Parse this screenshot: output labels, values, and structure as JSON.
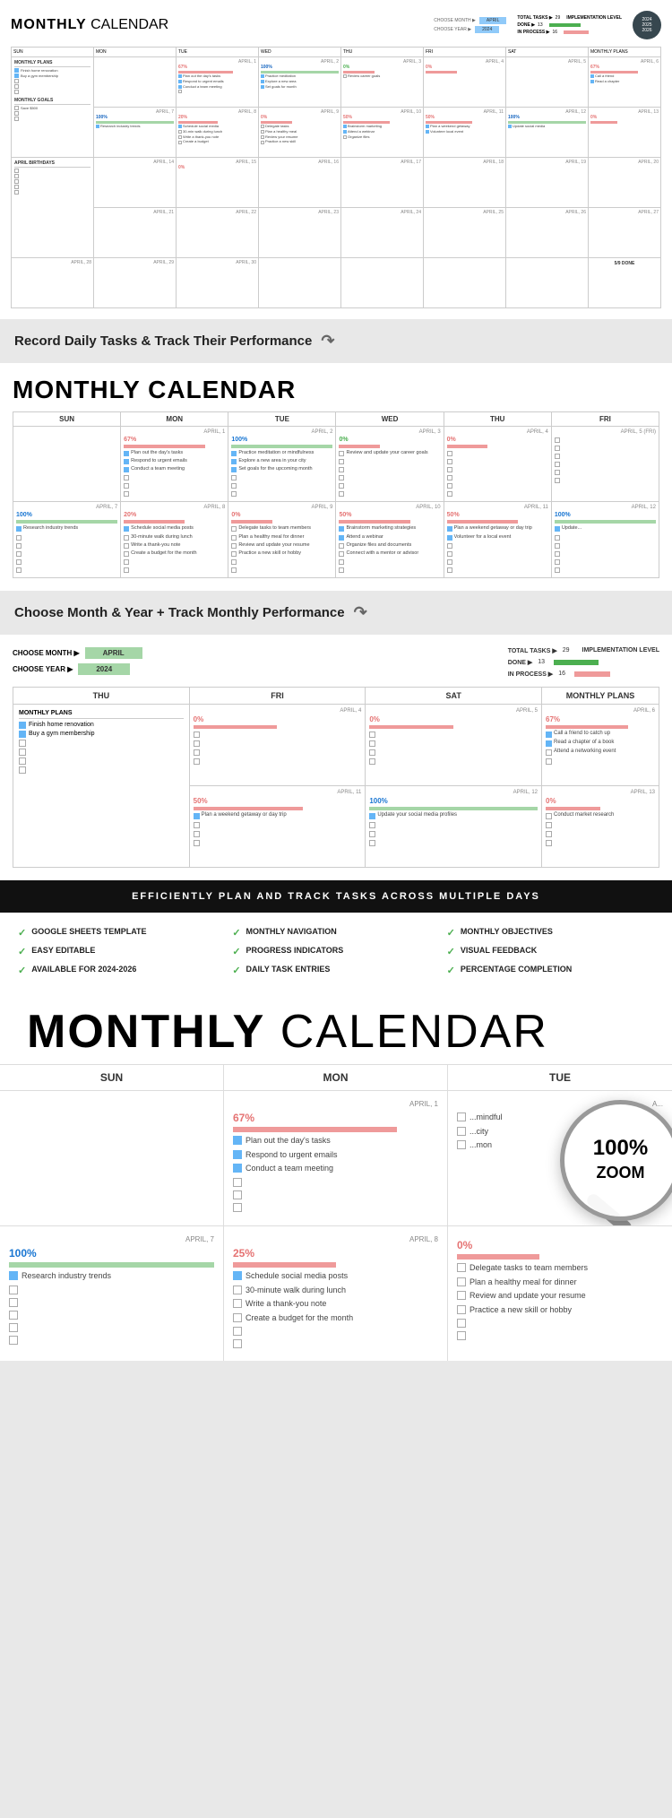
{
  "section1": {
    "title_bold": "MONTHLY",
    "title_light": " CALENDAR",
    "choose_month_label": "CHOOSE MONTH ▶",
    "choose_month_val": "APRIL",
    "choose_year_label": "CHOOSE YEAR ▶",
    "choose_year_val": "2024",
    "total_tasks_label": "TOTAL TASKS ▶",
    "total_tasks_val": "29",
    "done_label": "DONE ▶",
    "done_val": "13",
    "in_process_label": "IN PROCESS ▶",
    "in_process_val": "16",
    "impl_label": "IMPLEMENTATION LEVEL",
    "year_badge": [
      "2024",
      "2025",
      "2026"
    ],
    "days": [
      "SUN",
      "MON",
      "TUE",
      "WED",
      "THU",
      "FRI",
      "SAT"
    ],
    "right_panel_plans_title": "MONTHLY PLANS",
    "right_panel_plans": [
      "Finish home renovation",
      "Buy a gym membership",
      "",
      "",
      "",
      ""
    ],
    "right_panel_goals_title": "MONTHLY GOALS",
    "right_panel_goals": [
      "Save $500",
      "",
      "",
      "",
      ""
    ],
    "right_panel_bday_title": "APRIL BIRTHDAYS",
    "right_panel_bday": [
      "",
      "",
      "",
      "",
      ""
    ],
    "done_note": "5/9 DONE"
  },
  "divider1": {
    "text": "Record Daily Tasks & Track Their Performance"
  },
  "section2": {
    "title_bold": "MONTHLY",
    "title_light": " CALENDAR",
    "days": [
      "SUN",
      "MON",
      "TUE",
      "WED",
      "THU",
      "FRI"
    ],
    "row1": [
      {
        "date": "",
        "pct": "",
        "pct_class": "",
        "bar_class": "",
        "tasks": []
      },
      {
        "date": "APRIL, 1",
        "pct": "67%",
        "pct_class": "red",
        "bar_class": "pink",
        "tasks": [
          {
            "checked": true,
            "text": "Plan out the day's tasks"
          },
          {
            "checked": true,
            "text": "Respond to urgent emails"
          },
          {
            "checked": true,
            "text": "Conduct a team meeting"
          },
          {
            "checked": false,
            "text": ""
          },
          {
            "checked": false,
            "text": ""
          },
          {
            "checked": false,
            "text": ""
          }
        ]
      },
      {
        "date": "APRIL, 2",
        "pct": "100%",
        "pct_class": "blue",
        "bar_class": "green-bar",
        "tasks": [
          {
            "checked": true,
            "text": "Practice meditation or mindfulness"
          },
          {
            "checked": true,
            "text": "Explore a new area in your city"
          },
          {
            "checked": true,
            "text": "Set goals for the upcoming month"
          },
          {
            "checked": false,
            "text": ""
          },
          {
            "checked": false,
            "text": ""
          },
          {
            "checked": false,
            "text": ""
          }
        ]
      },
      {
        "date": "APRIL, 3",
        "pct": "0%",
        "pct_class": "green",
        "bar_class": "pink",
        "tasks": [
          {
            "checked": false,
            "text": "Review and update your career goals"
          },
          {
            "checked": false,
            "text": ""
          },
          {
            "checked": false,
            "text": ""
          },
          {
            "checked": false,
            "text": ""
          },
          {
            "checked": false,
            "text": ""
          },
          {
            "checked": false,
            "text": ""
          }
        ]
      },
      {
        "date": "APRIL, 4",
        "pct": "0%",
        "pct_class": "red",
        "bar_class": "pink",
        "tasks": [
          {
            "checked": false,
            "text": ""
          },
          {
            "checked": false,
            "text": ""
          },
          {
            "checked": false,
            "text": ""
          },
          {
            "checked": false,
            "text": ""
          },
          {
            "checked": false,
            "text": ""
          },
          {
            "checked": false,
            "text": ""
          }
        ]
      },
      {
        "date": "APRIL, 5 (FRI partial)",
        "pct": "",
        "pct_class": "",
        "bar_class": "",
        "tasks": []
      }
    ],
    "row2": [
      {
        "date": "APRIL, 7",
        "pct": "100%",
        "pct_class": "blue",
        "bar_class": "green-bar",
        "tasks": [
          {
            "checked": true,
            "text": "Research industry trends"
          },
          {
            "checked": false,
            "text": ""
          },
          {
            "checked": false,
            "text": ""
          },
          {
            "checked": false,
            "text": ""
          },
          {
            "checked": false,
            "text": ""
          },
          {
            "checked": false,
            "text": ""
          }
        ]
      },
      {
        "date": "APRIL, 8",
        "pct": "20%",
        "pct_class": "red",
        "bar_class": "pink",
        "tasks": [
          {
            "checked": true,
            "text": "Schedule social media posts"
          },
          {
            "checked": false,
            "text": "30-minute walk during lunch"
          },
          {
            "checked": false,
            "text": "Write a thank-you note"
          },
          {
            "checked": false,
            "text": "Create a budget for the month"
          },
          {
            "checked": false,
            "text": ""
          },
          {
            "checked": false,
            "text": ""
          }
        ]
      },
      {
        "date": "APRIL, 9",
        "pct": "0%",
        "pct_class": "red",
        "bar_class": "pink",
        "tasks": [
          {
            "checked": false,
            "text": "Delegate tasks to team members"
          },
          {
            "checked": false,
            "text": "Plan a healthy meal for dinner"
          },
          {
            "checked": false,
            "text": "Review and update your resume"
          },
          {
            "checked": false,
            "text": "Practice a new skill or hobby"
          },
          {
            "checked": false,
            "text": ""
          },
          {
            "checked": false,
            "text": ""
          }
        ]
      },
      {
        "date": "APRIL, 10",
        "pct": "50%",
        "pct_class": "red",
        "bar_class": "pink",
        "tasks": [
          {
            "checked": true,
            "text": "Brainstorm marketing strategies"
          },
          {
            "checked": true,
            "text": "Attend a webinar"
          },
          {
            "checked": false,
            "text": "Organize files and documents"
          },
          {
            "checked": false,
            "text": "Connect with a mentor or advisor"
          },
          {
            "checked": false,
            "text": ""
          },
          {
            "checked": false,
            "text": ""
          }
        ]
      },
      {
        "date": "APRIL, 11",
        "pct": "50%",
        "pct_class": "red",
        "bar_class": "pink",
        "tasks": [
          {
            "checked": true,
            "text": "Plan a weekend getaway or day trip"
          },
          {
            "checked": true,
            "text": "Volunteer for a local event"
          },
          {
            "checked": false,
            "text": ""
          },
          {
            "checked": false,
            "text": ""
          },
          {
            "checked": false,
            "text": ""
          },
          {
            "checked": false,
            "text": ""
          }
        ]
      },
      {
        "date": "APRIL, 12 (partial)",
        "pct": "100%",
        "pct_class": "blue",
        "bar_class": "green-bar",
        "tasks": [
          {
            "checked": false,
            "text": "Update..."
          },
          {
            "checked": false,
            "text": ""
          },
          {
            "checked": false,
            "text": ""
          },
          {
            "checked": false,
            "text": ""
          },
          {
            "checked": false,
            "text": ""
          },
          {
            "checked": false,
            "text": ""
          }
        ]
      }
    ]
  },
  "divider2": {
    "text": "Choose Month & Year + Track Monthly Performance"
  },
  "section3": {
    "choose_month_label": "CHOOSE MONTH ▶",
    "choose_month_val": "APRIL",
    "choose_year_label": "CHOOSE YEAR ▶",
    "choose_year_val": "2024",
    "total_tasks_label": "TOTAL TASKS ▶",
    "total_tasks_val": "29",
    "done_label": "DONE ▶",
    "done_val": "13",
    "in_process_label": "IN PROCESS ▶",
    "in_process_val": "16",
    "impl_label": "IMPLEMENTATION LEVEL",
    "days_partial": [
      "THU",
      "FRI",
      "SAT",
      "MONTHLY PLANS"
    ],
    "monthly_plans": [
      "Finish home renovation",
      "Buy a gym membership",
      "",
      "",
      "",
      ""
    ],
    "row1": [
      {
        "date": "APRIL, 4",
        "pct": "0%",
        "pct_class": "red",
        "bar_class": "pink",
        "tasks": [
          {
            "checked": false,
            "text": ""
          },
          {
            "checked": false,
            "text": ""
          },
          {
            "checked": false,
            "text": ""
          },
          {
            "checked": false,
            "text": ""
          }
        ]
      },
      {
        "date": "APRIL, 5",
        "pct": "0%",
        "pct_class": "red",
        "bar_class": "pink",
        "tasks": [
          {
            "checked": false,
            "text": ""
          },
          {
            "checked": false,
            "text": ""
          },
          {
            "checked": false,
            "text": ""
          },
          {
            "checked": false,
            "text": ""
          }
        ]
      },
      {
        "date": "APRIL, 6",
        "pct": "67%",
        "pct_class": "red",
        "bar_class": "pink",
        "tasks": [
          {
            "checked": true,
            "text": "Call a friend to catch up"
          },
          {
            "checked": true,
            "text": "Read a chapter of a book"
          },
          {
            "checked": false,
            "text": "Attend a networking event"
          },
          {
            "checked": false,
            "text": ""
          }
        ]
      }
    ],
    "row2": [
      {
        "date": "APRIL, 11",
        "pct": "50%",
        "pct_class": "red",
        "bar_class": "pink",
        "tasks": [
          {
            "checked": true,
            "text": "Plan a weekend getaway or day trip"
          },
          {
            "checked": false,
            "text": ""
          },
          {
            "checked": false,
            "text": ""
          },
          {
            "checked": false,
            "text": ""
          }
        ]
      },
      {
        "date": "APRIL, 12",
        "pct": "100%",
        "pct_class": "blue",
        "bar_class": "green-bar",
        "tasks": [
          {
            "checked": true,
            "text": "Update your social media profiles"
          },
          {
            "checked": false,
            "text": ""
          },
          {
            "checked": false,
            "text": ""
          },
          {
            "checked": false,
            "text": ""
          }
        ]
      },
      {
        "date": "APRIL, 13",
        "pct": "0%",
        "pct_class": "red",
        "bar_class": "pink",
        "tasks": [
          {
            "checked": false,
            "text": "Conduct market research"
          },
          {
            "checked": false,
            "text": ""
          },
          {
            "checked": false,
            "text": ""
          },
          {
            "checked": false,
            "text": ""
          }
        ]
      }
    ]
  },
  "black_banner": {
    "text": "EFFICIENTLY PLAN AND TRACK TASKS ACROSS MULTIPLE DAYS"
  },
  "features": [
    {
      "check": "✓",
      "text": "GOOGLE SHEETS TEMPLATE"
    },
    {
      "check": "✓",
      "text": "MONTHLY NAVIGATION"
    },
    {
      "check": "✓",
      "text": "MONTHLY OBJECTIVES"
    },
    {
      "check": "✓",
      "text": "EASY EDITABLE"
    },
    {
      "check": "✓",
      "text": "PROGRESS INDICATORS"
    },
    {
      "check": "✓",
      "text": "VISUAL FEEDBACK"
    },
    {
      "check": "✓",
      "text": "AVAILABLE FOR 2024-2026"
    },
    {
      "check": "✓",
      "text": "DAILY TASK ENTRIES"
    },
    {
      "check": "✓",
      "text": "PERCENTAGE COMPLETION"
    }
  ],
  "section4": {
    "title_bold": "MONTHLY",
    "title_light": " CALENDAR",
    "days": [
      "SUN",
      "MON",
      "TUE"
    ],
    "zoom_text": "100%\nZOOM",
    "row1": [
      {
        "date": "",
        "pct": "",
        "pct_class": "",
        "tasks": []
      },
      {
        "date": "APRIL, 1",
        "pct": "67%",
        "pct_class": "red",
        "bar_class": "pink",
        "tasks": [
          {
            "checked": true,
            "text": "Plan out the day's tasks"
          },
          {
            "checked": true,
            "text": "Respond to urgent emails"
          },
          {
            "checked": true,
            "text": "Conduct a team meeting"
          },
          {
            "checked": false,
            "text": ""
          },
          {
            "checked": false,
            "text": ""
          },
          {
            "checked": false,
            "text": ""
          }
        ]
      },
      {
        "date": "A...",
        "pct": "",
        "pct_class": "",
        "bar_class": "",
        "tasks": [
          {
            "checked": false,
            "text": "...mindful"
          },
          {
            "checked": false,
            "text": "...city"
          },
          {
            "checked": false,
            "text": "...mon"
          },
          {
            "checked": false,
            "text": ""
          },
          {
            "checked": false,
            "text": ""
          },
          {
            "checked": false,
            "text": ""
          }
        ]
      }
    ],
    "row2": [
      {
        "date": "APRIL, 7",
        "pct": "100%",
        "pct_class": "blue",
        "bar_class": "green-bar",
        "tasks": [
          {
            "checked": true,
            "text": "Research industry trends"
          },
          {
            "checked": false,
            "text": ""
          },
          {
            "checked": false,
            "text": ""
          },
          {
            "checked": false,
            "text": ""
          },
          {
            "checked": false,
            "text": ""
          },
          {
            "checked": false,
            "text": ""
          }
        ]
      },
      {
        "date": "APRIL, 8",
        "pct": "25%",
        "pct_class": "red",
        "bar_class": "pink",
        "tasks": [
          {
            "checked": true,
            "text": "Schedule social media posts"
          },
          {
            "checked": false,
            "text": "30-minute walk during lunch"
          },
          {
            "checked": false,
            "text": "Write a thank-you note"
          },
          {
            "checked": false,
            "text": "Create a budget for the month"
          },
          {
            "checked": false,
            "text": ""
          },
          {
            "checked": false,
            "text": ""
          }
        ]
      },
      {
        "date": "",
        "pct": "0%",
        "pct_class": "red",
        "bar_class": "pink",
        "tasks": [
          {
            "checked": false,
            "text": "Delegate tasks to team members"
          },
          {
            "checked": false,
            "text": "Plan a healthy meal for dinner"
          },
          {
            "checked": false,
            "text": "Review and update your resume"
          },
          {
            "checked": false,
            "text": "Practice a new skill or hobby"
          },
          {
            "checked": false,
            "text": ""
          },
          {
            "checked": false,
            "text": ""
          }
        ]
      }
    ]
  }
}
